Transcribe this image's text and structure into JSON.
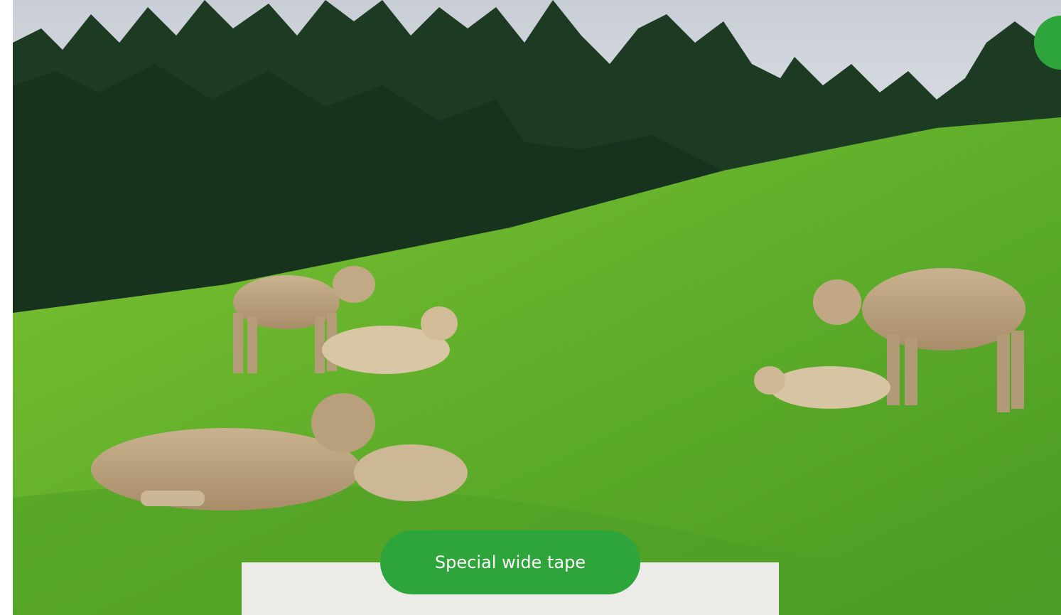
{
  "hero": {
    "image_subject": "cows-on-meadow"
  },
  "tag_button": {
    "label": "Special wide tape"
  },
  "colors": {
    "accent": "#2ea53a",
    "panel": "#ecebe8",
    "button_text": "#ffffff"
  }
}
